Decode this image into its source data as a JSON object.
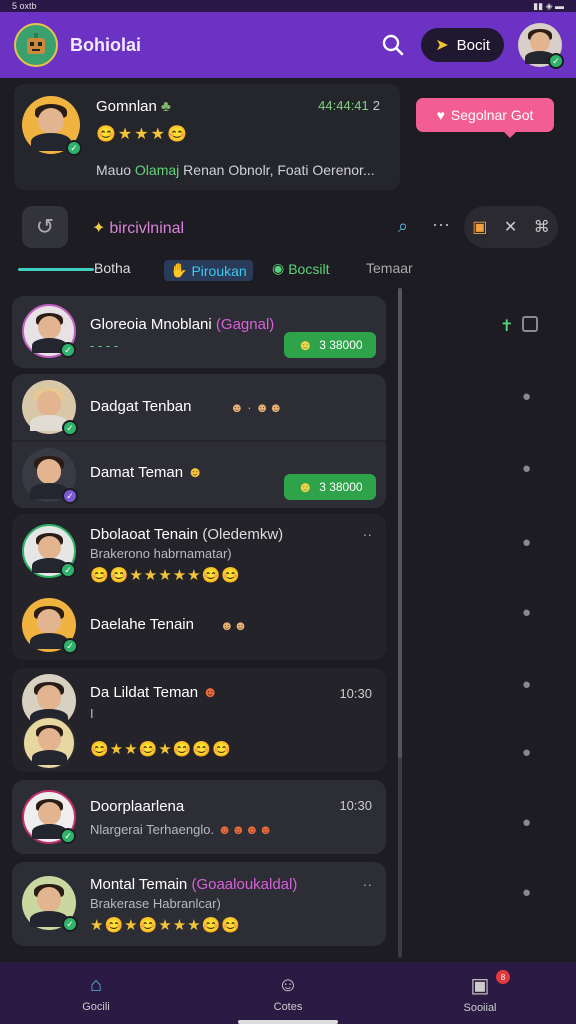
{
  "status": {
    "left": "5 oxtb",
    "right": ""
  },
  "header": {
    "title": "Bohiolai",
    "boost_label": "Bocit"
  },
  "featured": {
    "name": "Gomnlan",
    "count": "44:44:41",
    "count_suffix": "2",
    "stars": "😊★★★😊",
    "message_prefix": "Mauo",
    "message_highlight": "Olamaj",
    "message_rest": "Renan Obnolr, Foati Oerenor..."
  },
  "promo_button": "Segolnar Got",
  "section": {
    "title": "bircivlninal"
  },
  "tabs": [
    {
      "label": "Botha"
    },
    {
      "label": "Piroukan"
    },
    {
      "label": "Bocsilt"
    },
    {
      "label": "Temaar"
    }
  ],
  "chats": [
    {
      "title": "Gloreoia Mnoblani",
      "tag": "(Gagnal)",
      "sub": "- - - -",
      "pill": "3 38000"
    },
    {
      "title": "Dadgat Tenban",
      "sub": ""
    },
    {
      "title": "Damat Teman",
      "pill": "3 38000"
    },
    {
      "title": "Dbolaoat Tenain",
      "tag": "(Oledemkw)",
      "sub": "Brakerono habrnamatar)",
      "emojis": "😊😊★★★★★😊😊"
    },
    {
      "title": "Daelahe Tenain",
      "sub": ""
    },
    {
      "title": "Da Lildat Teman",
      "time": "10:30",
      "sub": "I",
      "emojis": "😊★★😊★😊😊😊"
    },
    {
      "title": "Doorplaarlena",
      "time": "10:30",
      "sub": "Nlargerai Terhaenglo."
    },
    {
      "title": "Montal Temain",
      "tag": "(Goaaloukaldal)",
      "sub": "Brakerase Habranlcar)",
      "emojis": "★😊★😊★★★😊😊"
    }
  ],
  "nav": [
    {
      "label": "Gocili"
    },
    {
      "label": "Cotes"
    },
    {
      "label": "Sooiial",
      "badge": "8"
    }
  ]
}
